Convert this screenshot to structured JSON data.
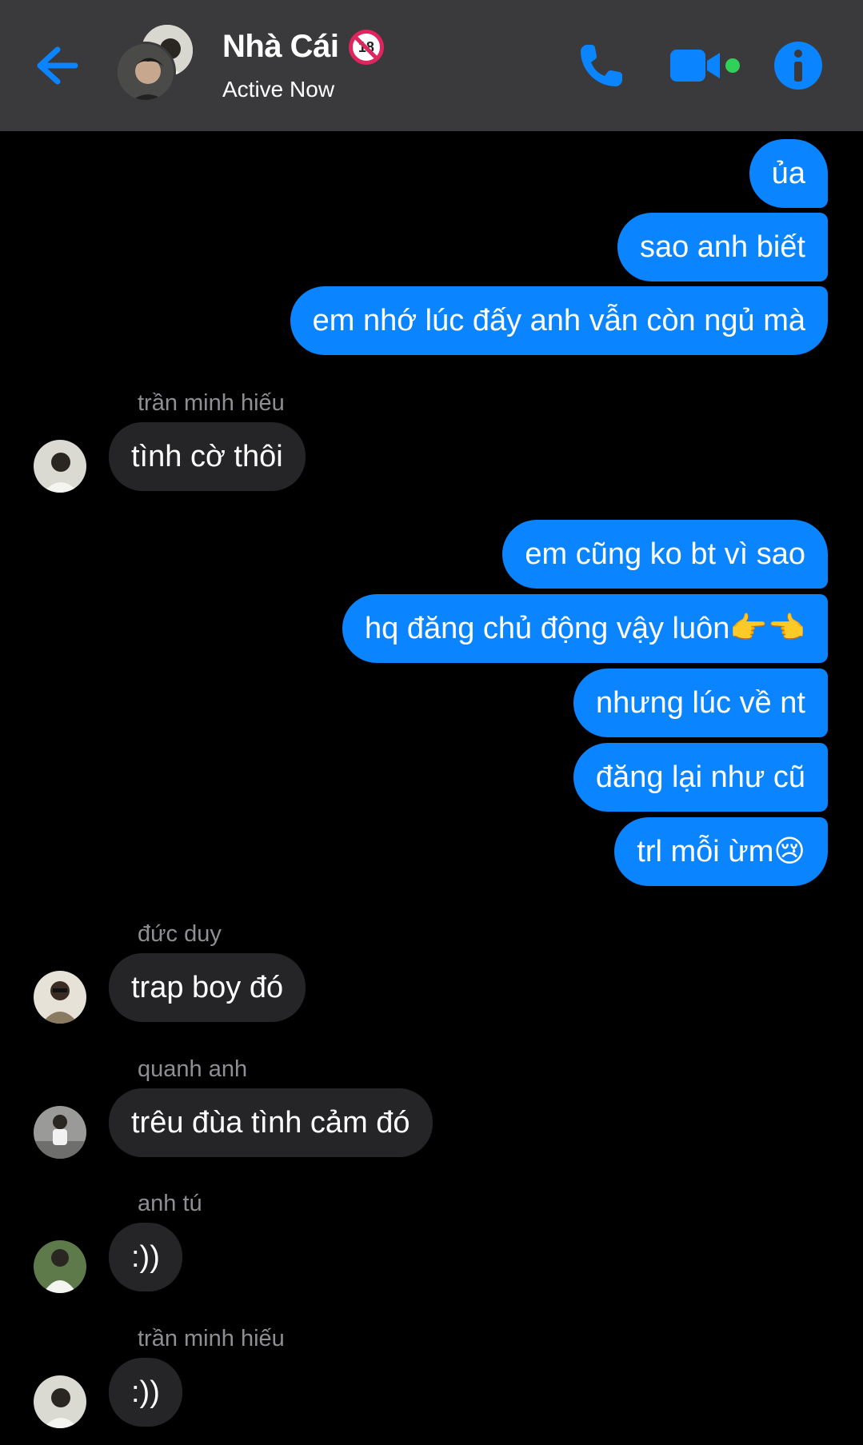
{
  "header": {
    "title": "Nhà Cái",
    "badge": "18",
    "status": "Active Now"
  },
  "colors": {
    "header_bg": "#3a3a3c",
    "accent": "#0a84ff",
    "outgoing_bubble": "#0a84ff",
    "incoming_bubble": "#252527",
    "sender_name": "#8e8e93",
    "online_dot": "#30d158"
  },
  "messages": [
    {
      "direction": "out",
      "text": "ủa"
    },
    {
      "direction": "out",
      "text": "sao anh biết"
    },
    {
      "direction": "out",
      "text": "em nhớ lúc đấy anh vẫn còn ngủ mà"
    },
    {
      "direction": "in",
      "sender": "trần minh hiếu",
      "text": "tình cờ thôi"
    },
    {
      "direction": "out",
      "text": "em cũng ko bt vì sao"
    },
    {
      "direction": "out",
      "text": "hq đăng chủ động vậy luôn👉👈"
    },
    {
      "direction": "out",
      "text": "nhưng lúc về nt"
    },
    {
      "direction": "out",
      "text": "đăng lại như cũ"
    },
    {
      "direction": "out",
      "text": "trl mỗi ừm😢"
    },
    {
      "direction": "in",
      "sender": "đức duy",
      "text": "trap boy đó"
    },
    {
      "direction": "in",
      "sender": "quanh anh",
      "text": "trêu đùa tình cảm đó"
    },
    {
      "direction": "in",
      "sender": "anh tú",
      "text": ":))"
    },
    {
      "direction": "in",
      "sender": "trần minh hiếu",
      "text": ":))"
    }
  ]
}
